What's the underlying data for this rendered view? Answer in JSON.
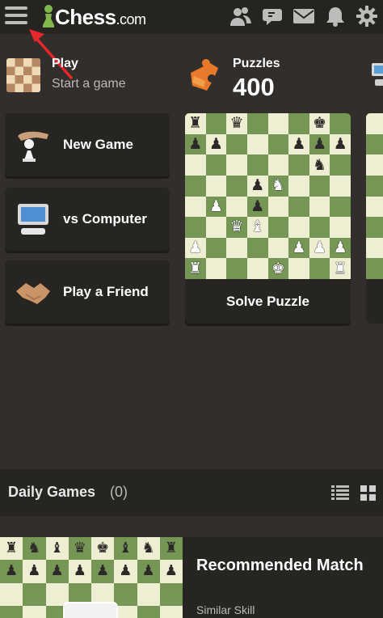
{
  "header": {
    "logo_text": "Chess",
    "logo_suffix": ".com",
    "icons": [
      "friends-icon",
      "chat-icon",
      "mail-icon",
      "bell-icon",
      "gear-icon"
    ]
  },
  "play": {
    "title": "Play",
    "subtitle": "Start a game",
    "cards": [
      {
        "label": "New Game",
        "icon": "pawn-hand-icon"
      },
      {
        "label": "vs Computer",
        "icon": "computer-icon"
      },
      {
        "label": "Play a Friend",
        "icon": "handshake-icon"
      }
    ]
  },
  "puzzles": {
    "title": "Puzzles",
    "rating": "400",
    "button_label": "Solve Puzzle",
    "board": [
      [
        "bR",
        "",
        "bQ",
        "",
        "",
        "",
        "bK",
        ""
      ],
      [
        "bP",
        "bP",
        "",
        "",
        "",
        "bP",
        "bP",
        "bP"
      ],
      [
        "",
        "",
        "",
        "",
        "",
        "",
        "bN",
        ""
      ],
      [
        "",
        "",
        "",
        "bP",
        "wN",
        "",
        "",
        ""
      ],
      [
        "",
        "wP",
        "",
        "bP",
        "",
        "",
        "",
        ""
      ],
      [
        "",
        "",
        "wQ",
        "wB",
        "",
        "",
        "",
        ""
      ],
      [
        "wP",
        "",
        "",
        "",
        "",
        "wP",
        "wP",
        "wP"
      ],
      [
        "wR",
        "",
        "",
        "",
        "wK",
        "",
        "",
        "wR"
      ]
    ]
  },
  "daily": {
    "title": "Daily Games",
    "count": "(0)",
    "recommended_title": "Recommended Match",
    "recommended_sub": "Similar Skill",
    "board": [
      [
        "bR",
        "bN",
        "bB",
        "bQ",
        "bK",
        "bB",
        "bN",
        "bR"
      ],
      [
        "bP",
        "bP",
        "bP",
        "bP",
        "bP",
        "bP",
        "bP",
        "bP"
      ],
      [
        "",
        "",
        "",
        "",
        "",
        "",
        "",
        ""
      ],
      [
        "",
        "",
        "",
        "",
        "",
        "",
        "",
        ""
      ]
    ]
  },
  "colors": {
    "background": "#312e2b",
    "light_square": "#eeeed2",
    "dark_square": "#769656",
    "accent_green": "#81b64c",
    "annotation_red": "#e8262b"
  }
}
